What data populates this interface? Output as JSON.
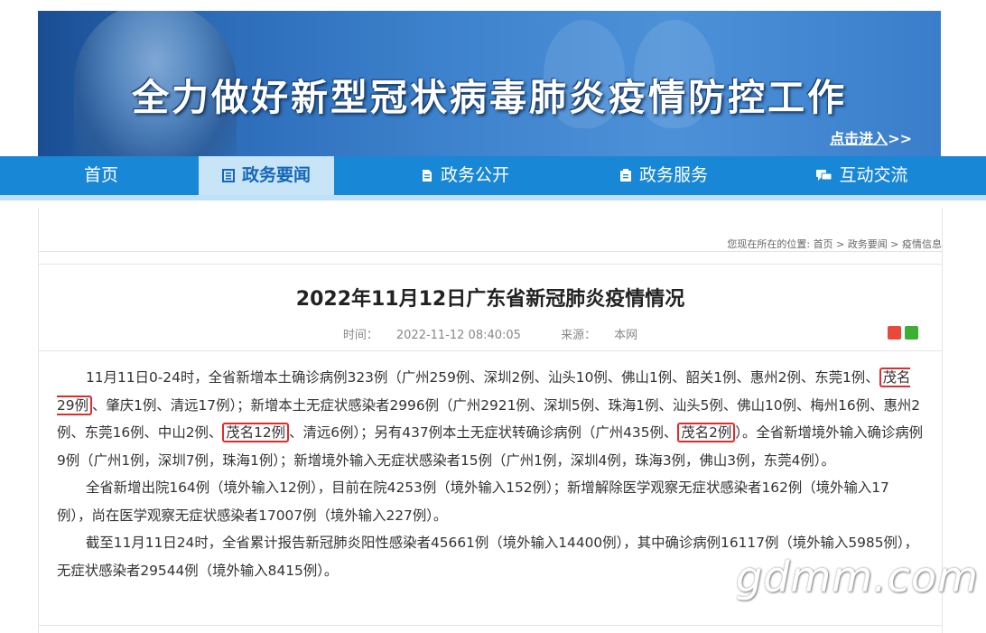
{
  "banner": {
    "title": "全力做好新型冠状病毒肺炎疫情防控工作",
    "enter_label": "点击进入",
    "enter_arrows": ">>"
  },
  "nav": {
    "items": [
      {
        "label": "首页"
      },
      {
        "label": "政务要闻",
        "icon": "news-icon"
      },
      {
        "label": "政务公开",
        "icon": "document-icon"
      },
      {
        "label": "政务服务",
        "icon": "service-icon"
      },
      {
        "label": "互动交流",
        "icon": "chat-icon"
      }
    ],
    "active_color": "#1566b8",
    "bar_color": "#1787d6"
  },
  "breadcrumb": {
    "prefix": "您现在所在的位置:",
    "items": [
      "首页",
      "政务要闻",
      "疫情信息"
    ],
    "sep": ">"
  },
  "article": {
    "title": "2022年11月12日广东省新冠肺炎疫情情况",
    "time_label": "时间：",
    "time": "2022-11-12 08:40:05",
    "source_label": "来源：",
    "source": "本网",
    "share_icons": [
      "weibo-icon",
      "wechat-icon"
    ],
    "p1": {
      "a": "11月11日0-24时，全省新增本土确诊病例323例（广州259例、深圳2例、汕头10例、佛山1例、韶关1例、惠州2例、东莞1例、",
      "h1": "茂名29例",
      "b": "、肇庆1例、清远17例）；新增本土无症状感染者2996例（广州2921例、深圳5例、珠海1例、汕头5例、佛山10例、梅州16例、惠州2例、东莞16例、中山2例、",
      "h2": "茂名12例",
      "c": "、清远6例）；另有437例本土无症状转确诊病例（广州435例、",
      "h3": "茂名2例",
      "d": "）。全省新增境外输入确诊病例9例（广州1例，深圳7例，珠海1例）；新增境外输入无症状感染者15例（广州1例，深圳4例，珠海3例，佛山3例，东莞4例）。"
    },
    "p2": "全省新增出院164例（境外输入12例），目前在院4253例（境外输入152例）；新增解除医学观察无症状感染者162例（境外输入17例），尚在医学观察无症状感染者17007例（境外输入227例）。",
    "p3": "截至11月11日24时，全省累计报告新冠肺炎阳性感染者45661例（境外输入14400例），其中确诊病例16117例（境外输入5985例），无症状感染者29544例（境外输入8415例）。"
  },
  "watermark": "gdmm.com",
  "highlight_color": "#e12b2b"
}
